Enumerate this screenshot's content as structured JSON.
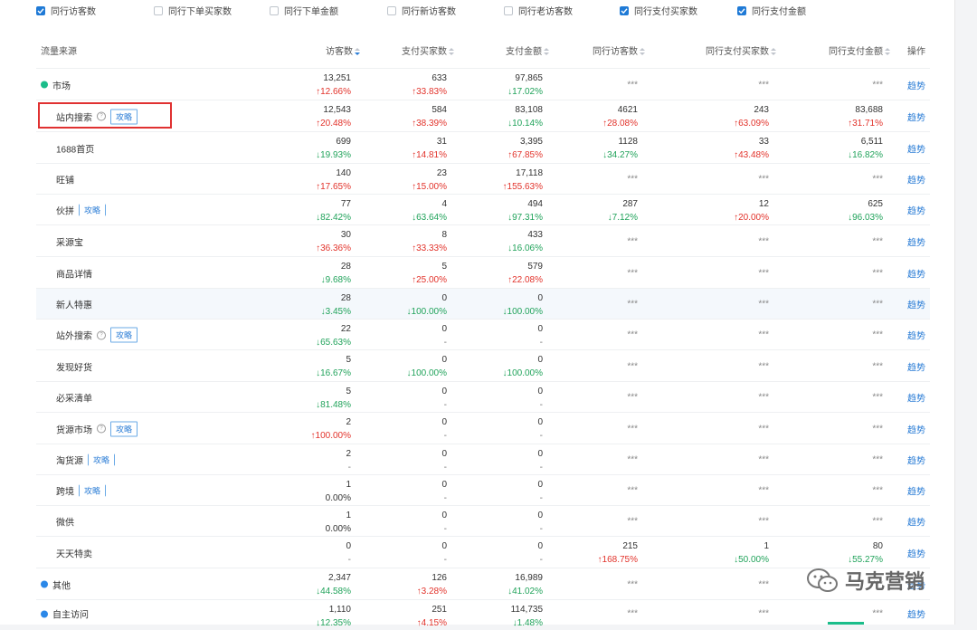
{
  "filters": [
    {
      "label": "同行访客数",
      "checked": true
    },
    {
      "label": "同行下单买家数",
      "checked": false
    },
    {
      "label": "同行下单金额",
      "checked": false
    },
    {
      "label": "同行新访客数",
      "checked": false
    },
    {
      "label": "同行老访客数",
      "checked": false
    },
    {
      "label": "同行支付买家数",
      "checked": true
    },
    {
      "label": "同行支付金额",
      "checked": true
    }
  ],
  "headers": {
    "source": "流量来源",
    "visitors": "访客数",
    "buyers": "支付买家数",
    "amount": "支付金额",
    "peer_visitors": "同行访客数",
    "peer_buyers": "同行支付买家数",
    "peer_amount": "同行支付金额",
    "ops": "操作"
  },
  "op_label": "趋势",
  "guide_label": "攻略",
  "help_label": "?",
  "rows": [
    {
      "name": "市场",
      "type": "group",
      "dot": "green",
      "c": [
        [
          "13,251",
          "↑12.66%",
          "up"
        ],
        [
          "633",
          "↑33.83%",
          "up"
        ],
        [
          "97,865",
          "↓17.02%",
          "down"
        ]
      ],
      "p": [
        "***",
        "***",
        "***"
      ]
    },
    {
      "name": "站内搜索",
      "type": "sub",
      "help": true,
      "guide": "box",
      "c": [
        [
          "12,543",
          "↑20.48%",
          "up"
        ],
        [
          "584",
          "↑38.39%",
          "up"
        ],
        [
          "83,108",
          "↓10.14%",
          "down"
        ]
      ],
      "p": [
        [
          "4621",
          "↑28.08%",
          "up"
        ],
        [
          "243",
          "↑63.09%",
          "up"
        ],
        [
          "83,688",
          "↑31.71%",
          "up"
        ]
      ]
    },
    {
      "name": "1688首页",
      "type": "sub",
      "c": [
        [
          "699",
          "↓19.93%",
          "down"
        ],
        [
          "31",
          "↑14.81%",
          "up"
        ],
        [
          "3,395",
          "↑67.85%",
          "up"
        ]
      ],
      "p": [
        [
          "1128",
          "↓34.27%",
          "down"
        ],
        [
          "33",
          "↑43.48%",
          "up"
        ],
        [
          "6,511",
          "↓16.82%",
          "down"
        ]
      ]
    },
    {
      "name": "旺铺",
      "type": "sub",
      "c": [
        [
          "140",
          "↑17.65%",
          "up"
        ],
        [
          "23",
          "↑15.00%",
          "up"
        ],
        [
          "17,118",
          "↑155.63%",
          "up"
        ]
      ],
      "p": [
        "***",
        "***",
        "***"
      ]
    },
    {
      "name": "伙拼",
      "type": "sub",
      "guide": "plain",
      "c": [
        [
          "77",
          "↓82.42%",
          "down"
        ],
        [
          "4",
          "↓63.64%",
          "down"
        ],
        [
          "494",
          "↓97.31%",
          "down"
        ]
      ],
      "p": [
        [
          "287",
          "↓7.12%",
          "down"
        ],
        [
          "12",
          "↑20.00%",
          "up"
        ],
        [
          "625",
          "↓96.03%",
          "down"
        ]
      ]
    },
    {
      "name": "采源宝",
      "type": "sub",
      "c": [
        [
          "30",
          "↑36.36%",
          "up"
        ],
        [
          "8",
          "↑33.33%",
          "up"
        ],
        [
          "433",
          "↓16.06%",
          "down"
        ]
      ],
      "p": [
        "***",
        "***",
        "***"
      ]
    },
    {
      "name": "商品详情",
      "type": "sub",
      "c": [
        [
          "28",
          "↓9.68%",
          "down"
        ],
        [
          "5",
          "↑25.00%",
          "up"
        ],
        [
          "579",
          "↑22.08%",
          "up"
        ]
      ],
      "p": [
        "***",
        "***",
        "***"
      ]
    },
    {
      "name": "新人特惠",
      "type": "sub",
      "hl": true,
      "c": [
        [
          "28",
          "↓3.45%",
          "down"
        ],
        [
          "0",
          "↓100.00%",
          "down"
        ],
        [
          "0",
          "↓100.00%",
          "down"
        ]
      ],
      "p": [
        "***",
        "***",
        "***"
      ]
    },
    {
      "name": "站外搜索",
      "type": "sub",
      "help": true,
      "guide": "box",
      "c": [
        [
          "22",
          "↓65.63%",
          "down"
        ],
        [
          "0",
          "-",
          "dash"
        ],
        [
          "0",
          "-",
          "dash"
        ]
      ],
      "p": [
        "***",
        "***",
        "***"
      ]
    },
    {
      "name": "发现好货",
      "type": "sub",
      "c": [
        [
          "5",
          "↓16.67%",
          "down"
        ],
        [
          "0",
          "↓100.00%",
          "down"
        ],
        [
          "0",
          "↓100.00%",
          "down"
        ]
      ],
      "p": [
        "***",
        "***",
        "***"
      ]
    },
    {
      "name": "必采清单",
      "type": "sub",
      "c": [
        [
          "5",
          "↓81.48%",
          "down"
        ],
        [
          "0",
          "-",
          "dash"
        ],
        [
          "0",
          "-",
          "dash"
        ]
      ],
      "p": [
        "***",
        "***",
        "***"
      ]
    },
    {
      "name": "货源市场",
      "type": "sub",
      "help": true,
      "guide": "box",
      "c": [
        [
          "2",
          "↑100.00%",
          "up"
        ],
        [
          "0",
          "-",
          "dash"
        ],
        [
          "0",
          "-",
          "dash"
        ]
      ],
      "p": [
        "***",
        "***",
        "***"
      ]
    },
    {
      "name": "淘货源",
      "type": "sub",
      "guide": "plain",
      "c": [
        [
          "2",
          "-",
          "dash"
        ],
        [
          "0",
          "-",
          "dash"
        ],
        [
          "0",
          "-",
          "dash"
        ]
      ],
      "p": [
        "***",
        "***",
        "***"
      ]
    },
    {
      "name": "跨境",
      "type": "sub",
      "guide": "plain",
      "c": [
        [
          "1",
          "0.00%",
          "flat"
        ],
        [
          "0",
          "-",
          "dash"
        ],
        [
          "0",
          "-",
          "dash"
        ]
      ],
      "p": [
        "***",
        "***",
        "***"
      ]
    },
    {
      "name": "微供",
      "type": "sub",
      "c": [
        [
          "1",
          "0.00%",
          "flat"
        ],
        [
          "0",
          "-",
          "dash"
        ],
        [
          "0",
          "-",
          "dash"
        ]
      ],
      "p": [
        "***",
        "***",
        "***"
      ]
    },
    {
      "name": "天天特卖",
      "type": "sub",
      "c": [
        [
          "0",
          "-",
          "dash"
        ],
        [
          "0",
          "-",
          "dash"
        ],
        [
          "0",
          "-",
          "dash"
        ]
      ],
      "p": [
        [
          "215",
          "↑168.75%",
          "up"
        ],
        [
          "1",
          "↓50.00%",
          "down"
        ],
        [
          "80",
          "↓55.27%",
          "down"
        ]
      ]
    },
    {
      "name": "其他",
      "type": "group",
      "dot": "blue",
      "c": [
        [
          "2,347",
          "↓44.58%",
          "down"
        ],
        [
          "126",
          "↑3.28%",
          "up"
        ],
        [
          "16,989",
          "↓41.02%",
          "down"
        ]
      ],
      "p": [
        "***",
        "***",
        "***"
      ]
    },
    {
      "name": "自主访问",
      "type": "group",
      "dot": "blue",
      "c": [
        [
          "1,110",
          "↓12.35%",
          "down"
        ],
        [
          "251",
          "↑4.15%",
          "up"
        ],
        [
          "114,735",
          "↓1.48%",
          "down"
        ]
      ],
      "p": [
        "***",
        "***",
        "***"
      ]
    }
  ],
  "watermark": "马克营销",
  "colors": {
    "up": "#e2332b",
    "down": "#21a35b",
    "link": "#2b7dd6",
    "check": "#1f7ad6",
    "highlight_box": "#e03131"
  }
}
